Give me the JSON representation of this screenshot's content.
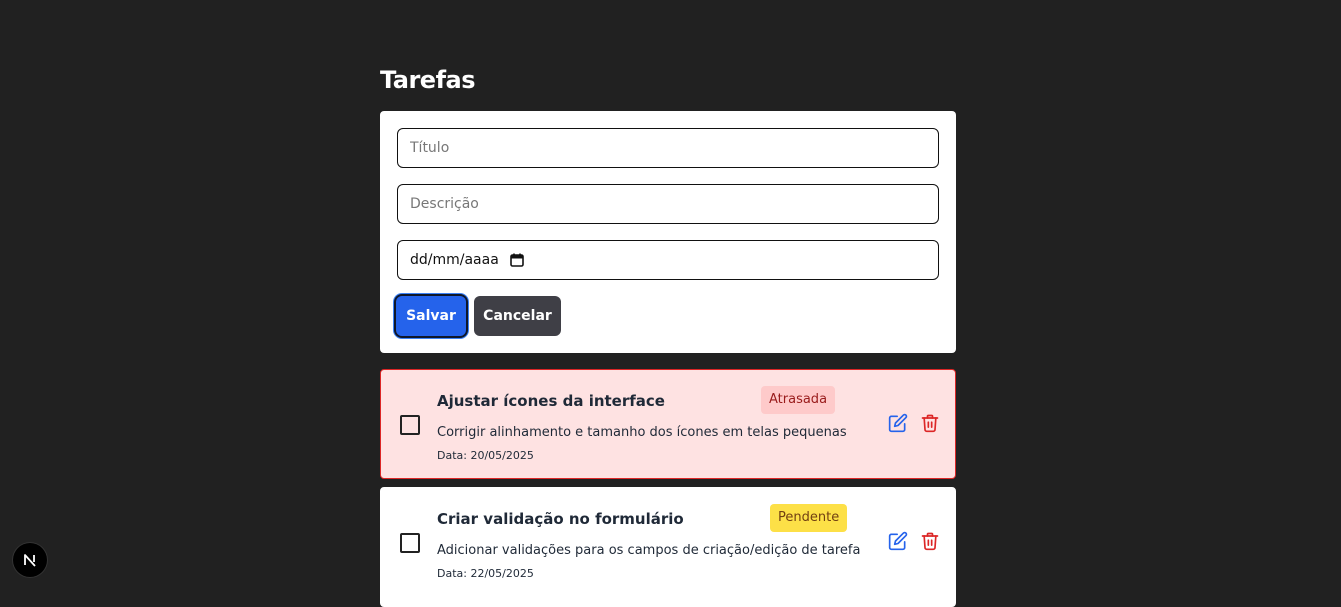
{
  "page": {
    "title": "Tarefas"
  },
  "form": {
    "title_placeholder": "Título",
    "description_placeholder": "Descrição",
    "date_value": "dd/mm/aaaa",
    "save_label": "Salvar",
    "cancel_label": "Cancelar"
  },
  "tasks": [
    {
      "title": "Ajustar ícones da interface",
      "status": "Atrasada",
      "description": "Corrigir alinhamento e tamanho dos ícones em telas pequenas",
      "date": "Data: 20/05/2025",
      "completed": false
    },
    {
      "title": "Criar validação no formulário",
      "status": "Pendente",
      "description": "Adicionar validações para os campos de criação/edição de tarefa",
      "date": "Data: 22/05/2025",
      "completed": false
    }
  ],
  "icons": {
    "edit": "pencil-square-icon",
    "delete": "trash-icon",
    "calendar": "calendar-icon",
    "framework": "nextjs-logo"
  },
  "colors": {
    "background": "#212121",
    "primary": "#2563eb",
    "danger": "#dc2626",
    "late_bg": "#fee2e2",
    "pending_badge": "#fde047"
  }
}
